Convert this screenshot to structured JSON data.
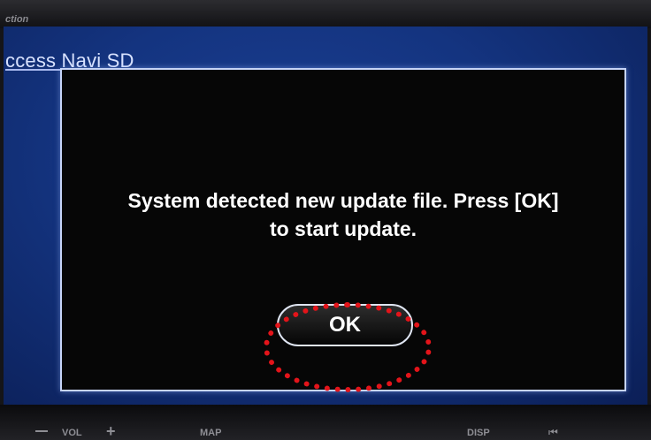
{
  "device": {
    "brand_label": "ction",
    "screen_title": "ccess Navi SD"
  },
  "dialog": {
    "message_line1": "System detected new update file. Press [OK]",
    "message_line2": "to start update.",
    "ok_label": "OK"
  },
  "hardware_buttons": {
    "vol_label": "VOL",
    "map_label": "MAP",
    "disp_label": "DISP",
    "prev_icon": "prev-track-icon"
  },
  "colors": {
    "screen_blue": "#143480",
    "dialog_bg": "#060606",
    "highlight_red": "#e3141a"
  }
}
